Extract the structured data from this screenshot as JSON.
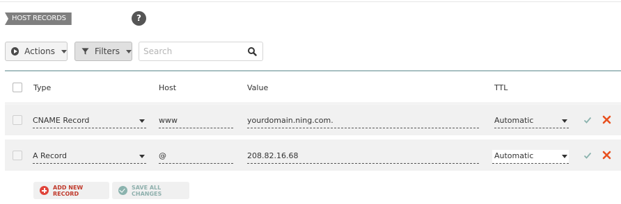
{
  "section": {
    "title": "HOST RECORDS",
    "help_icon": "question-icon",
    "help_symbol": "?"
  },
  "toolbar": {
    "actions_label": "Actions",
    "filters_label": "Filters",
    "search_placeholder": "Search"
  },
  "table": {
    "headers": {
      "type": "Type",
      "host": "Host",
      "value": "Value",
      "ttl": "TTL"
    },
    "rows": [
      {
        "type": "CNAME Record",
        "host": "www",
        "value": "yourdomain.ning.com.",
        "ttl": "Automatic"
      },
      {
        "type": "A Record",
        "host": "@",
        "value": "208.82.16.68",
        "ttl": "Automatic"
      }
    ]
  },
  "footer": {
    "add_label": "ADD NEW RECORD",
    "save_label": "SAVE ALL CHANGES"
  },
  "colors": {
    "accent_border": "#a7bfc1",
    "confirm_green": "#8bb3ae",
    "delete_orange": "#e8501e",
    "add_red": "#e0443a"
  }
}
